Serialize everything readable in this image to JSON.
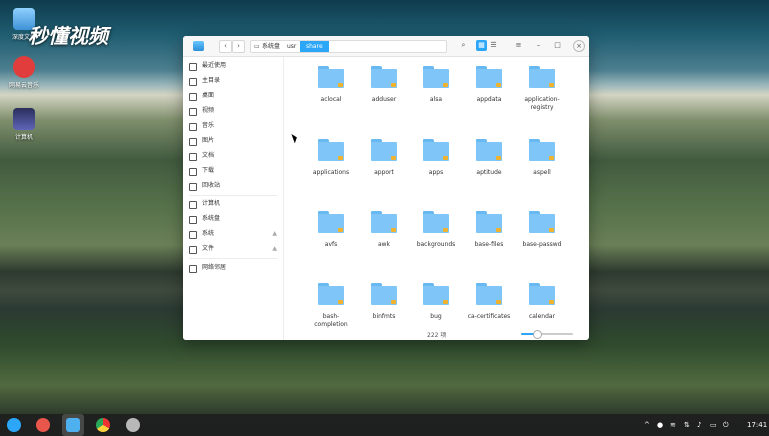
{
  "desktop": {
    "icons": [
      {
        "label": "深度文件",
        "icon": "file-manager-icon"
      },
      {
        "label": "网易云音乐",
        "icon": "music-app-icon"
      },
      {
        "label": "计算机",
        "icon": "computer-icon"
      }
    ],
    "watermark": "秒懂视频"
  },
  "window": {
    "breadcrumb": [
      "系统盘",
      "usr",
      "share"
    ],
    "sidebar": {
      "items": [
        {
          "label": "最近使用",
          "icon": "clock-icon"
        },
        {
          "label": "主目录",
          "icon": "home-icon"
        },
        {
          "label": "桌面",
          "icon": "desktop-icon"
        },
        {
          "label": "视频",
          "icon": "video-icon"
        },
        {
          "label": "音乐",
          "icon": "music-icon"
        },
        {
          "label": "图片",
          "icon": "image-icon"
        },
        {
          "label": "文档",
          "icon": "document-icon"
        },
        {
          "label": "下载",
          "icon": "download-icon"
        },
        {
          "label": "回收站",
          "icon": "trash-icon"
        },
        {
          "label": "计算机",
          "icon": "computer-icon"
        },
        {
          "label": "系统盘",
          "icon": "disk-icon"
        },
        {
          "label": "系统",
          "icon": "disk-icon"
        },
        {
          "label": "文件",
          "icon": "disk-icon"
        },
        {
          "label": "网络邻居",
          "icon": "network-icon"
        }
      ]
    },
    "files": [
      "aclocal",
      "adduser",
      "alsa",
      "appdata",
      "application-\nregistry",
      "applications",
      "apport",
      "apps",
      "aptitude",
      "aspell",
      "avfs",
      "awk",
      "backgrounds",
      "base-files",
      "base-passwd",
      "bash-\ncompletion",
      "binfmts",
      "bug",
      "ca-certificates",
      "calendar"
    ],
    "status": "222 项",
    "zoom_level": 0.3
  },
  "taskbar": {
    "apps": [
      "launcher-icon",
      "screen-recorder-icon",
      "file-manager-icon",
      "chrome-icon",
      "settings-icon"
    ],
    "clock": "17:41",
    "colors": {
      "accent": "#2ca7f8"
    }
  }
}
